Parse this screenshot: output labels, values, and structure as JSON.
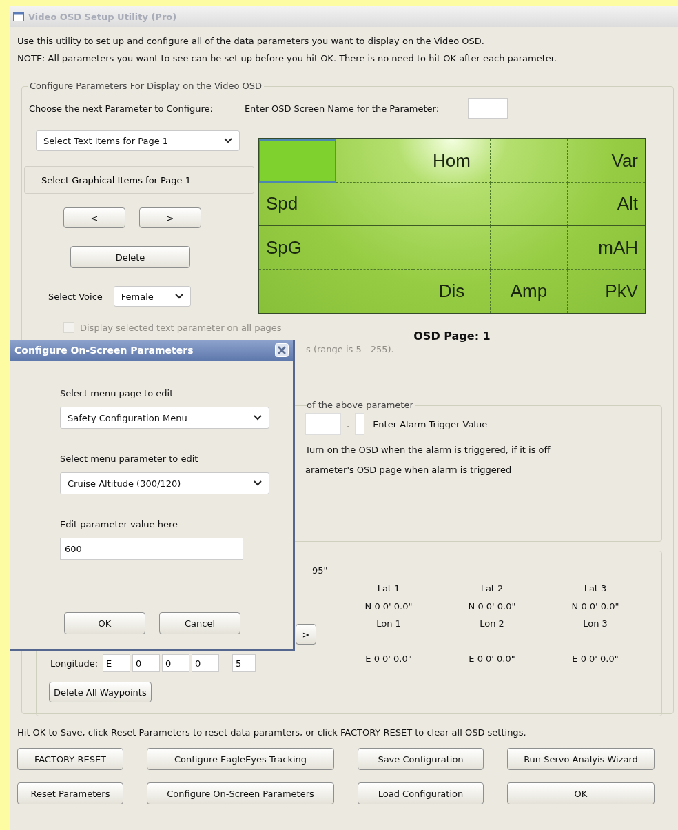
{
  "window": {
    "title": "Video OSD Setup Utility (Pro)",
    "active": false
  },
  "intro": [
    "Use this utility to set up and configure all of the data parameters you want to display on the Video OSD.",
    "NOTE:  All parameters you want to see can be set up before you hit OK. There is no need to hit OK after each parameter."
  ],
  "config_group": {
    "legend": "Configure Parameters For Display on the Video OSD",
    "parameter_label": "Choose the next Parameter to Configure:",
    "screen_name_label": "Enter OSD Screen Name for the Parameter:",
    "text_items_select": "Select Text Items for Page 1",
    "graphical_items": "Select Graphical Items for Page 1",
    "nav_buttons": [
      "<",
      ">"
    ],
    "delete_button": "Delete",
    "voice": {
      "label": "Select Voice",
      "value": "Female"
    },
    "osd_grid": [
      [
        {
          "selected": true
        },
        {
          "selected": false
        },
        {
          "text": "Hom",
          "selected": false
        },
        {
          "selected": false
        },
        {
          "text": "Var",
          "selected": false
        }
      ],
      [
        {
          "text": "Spd",
          "selected": false
        },
        {
          "selected": false
        },
        {
          "selected": false
        },
        {
          "selected": false
        },
        {
          "text": "Alt",
          "selected": false
        }
      ],
      [
        {
          "text": "SpG",
          "selected": false
        },
        {
          "selected": false
        },
        {
          "selected": false
        },
        {
          "selected": false
        },
        {
          "text": "mAH",
          "selected": false
        }
      ],
      [
        {
          "selected": false
        },
        {
          "selected": false
        },
        {
          "text": "Dis",
          "selected": false
        },
        {
          "text": "Amp",
          "selected": false
        },
        {
          "text": "PkV",
          "selected": false
        }
      ]
    ],
    "osd_page_label": "OSD Page: 1",
    "all_pages_checkbox": {
      "label": "Display selected text parameter on all pages",
      "checked": false,
      "disabled": true
    },
    "range_note": "s (range is 5 - 255).",
    "alarm_group": {
      "legend": "of the above parameter",
      "separator": ".",
      "trigger_label": "Enter Alarm Trigger Value",
      "lines": [
        "Turn on the OSD when the alarm is triggered, if it is off",
        "arameter's OSD page when alarm is triggered"
      ]
    },
    "waypoints": {
      "position_fragment": "95\"",
      "next_button": ">",
      "columns": [
        {
          "lat_label": "Lat 1",
          "lat_value": "N 0 0' 0.0\"",
          "lon_label": "Lon 1",
          "lon_value": "E 0 0' 0.0\""
        },
        {
          "lat_label": "Lat 2",
          "lat_value": "N 0 0' 0.0\"",
          "lon_label": "Lon 2",
          "lon_value": "E 0 0' 0.0\""
        },
        {
          "lat_label": "Lat 3",
          "lat_value": "N 0 0' 0.0\"",
          "lon_label": "Lon 3",
          "lon_value": "E 0 0' 0.0\""
        }
      ],
      "longitude": {
        "label": "Longitude:",
        "fields": [
          "E",
          "0",
          "0",
          "0",
          "5"
        ]
      },
      "delete_button": "Delete All Waypoints"
    }
  },
  "footer_text": "Hit OK to Save, click Reset Parameters to reset data paramters, or click FACTORY RESET to clear all OSD settings.",
  "buttons": [
    [
      "FACTORY RESET",
      "Configure EagleEyes Tracking",
      "Save Configuration",
      "Run Servo Analyis Wizard"
    ],
    [
      "Reset Parameters",
      "Configure On-Screen Parameters",
      "Load Configuration",
      "OK"
    ]
  ],
  "dialog": {
    "title": "Configure On-Screen Parameters",
    "page_label": "Select menu page to edit",
    "page_value": "Safety Configuration Menu",
    "param_label": "Select menu parameter to edit",
    "param_value": "Cruise Altitude (300/120)",
    "value_label": "Edit parameter value here",
    "value": "600",
    "buttons": [
      "OK",
      "Cancel"
    ]
  }
}
